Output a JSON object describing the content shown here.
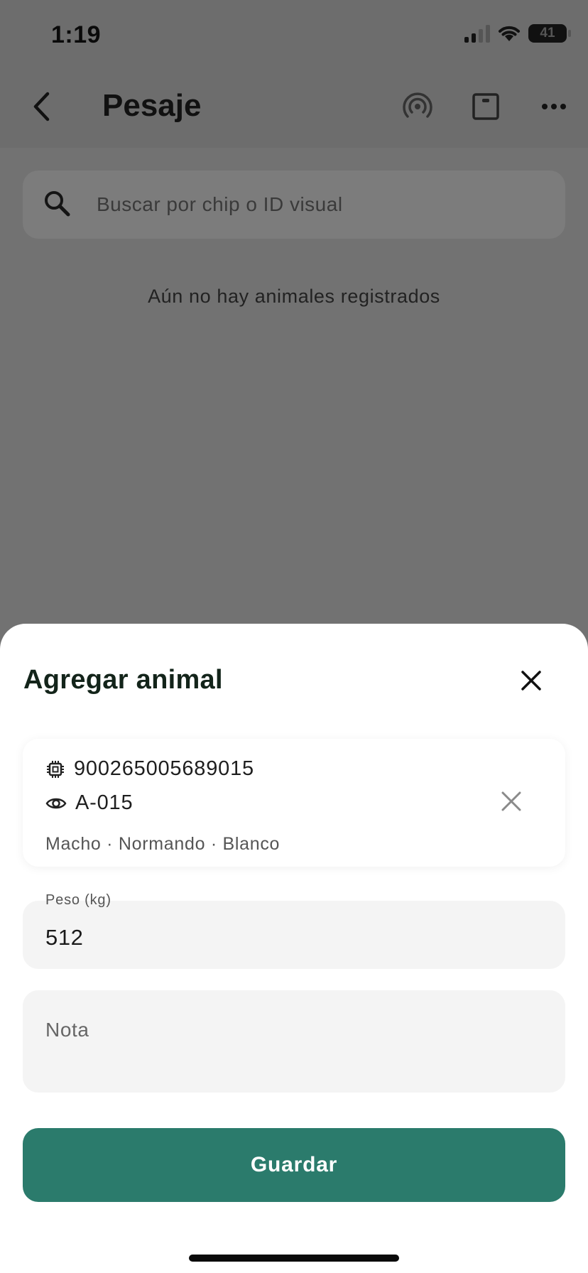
{
  "status_bar": {
    "time": "1:19",
    "battery": "41"
  },
  "header": {
    "title": "Pesaje"
  },
  "search": {
    "placeholder": "Buscar por chip o ID visual"
  },
  "list": {
    "empty_message": "Aún no hay animales registrados"
  },
  "sheet": {
    "title": "Agregar animal",
    "animal": {
      "chip_id": "900265005689015",
      "visual_id": "A-015",
      "details": "Macho · Normando · Blanco"
    },
    "weight": {
      "label": "Peso (kg)",
      "value": "512"
    },
    "note": {
      "placeholder": "Nota",
      "value": ""
    },
    "save_label": "Guardar"
  },
  "icons": {
    "back": "chevron-left-icon",
    "rfid": "rfid-scan-icon",
    "scale": "scale-icon",
    "more": "more-horizontal-icon",
    "search": "search-icon",
    "close": "close-icon",
    "chip": "chip-icon",
    "eye": "eye-icon"
  },
  "colors": {
    "accent": "#2b7b6c",
    "overlay": "#727272",
    "sheet_bg": "#ffffff",
    "field_bg": "#f4f4f4"
  }
}
